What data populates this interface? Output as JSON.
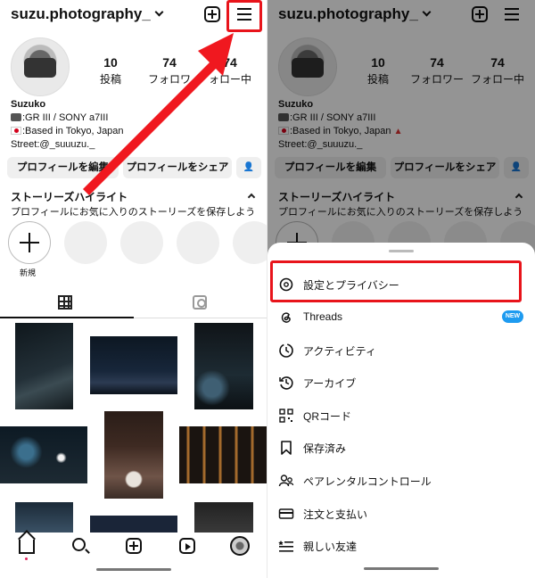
{
  "profile": {
    "username": "suzu.photography_",
    "posts": "10",
    "posts_label": "投稿",
    "followers": "74",
    "followers_label": "フォロワー",
    "following": "74",
    "following_label": "フォロー中",
    "name": "Suzuko",
    "bio_camera": ":GR III / SONY a7III",
    "bio_location": ":Based in Tokyo, Japan",
    "bio_street": "Street:@_suuuzu._",
    "edit_label": "プロフィールを編集",
    "share_label": "プロフィールをシェア"
  },
  "left_ui": {
    "followers_label_visible": "フォロワ",
    "following_label_visible": "ォロー中",
    "edit_label_visible": "プロフィールを編集",
    "share_label_visible": "プロフィールをシェア"
  },
  "highlights": {
    "title": "ストーリーズハイライト",
    "subtitle": "プロフィールにお気に入りのストーリーズを保存しよう",
    "new_label": "新規"
  },
  "menu": {
    "new_badge": "NEW",
    "items": [
      {
        "label": "設定とプライバシー",
        "icon": "settings-icon"
      },
      {
        "label": "Threads",
        "icon": "threads-icon"
      },
      {
        "label": "アクティビティ",
        "icon": "activity-icon"
      },
      {
        "label": "アーカイブ",
        "icon": "archive-icon"
      },
      {
        "label": "QRコード",
        "icon": "qr-code-icon"
      },
      {
        "label": "保存済み",
        "icon": "bookmark-icon"
      },
      {
        "label": "ペアレンタルコントロール",
        "icon": "parental-control-icon"
      },
      {
        "label": "注文と支払い",
        "icon": "card-icon"
      },
      {
        "label": "親しい友達",
        "icon": "close-friends-icon"
      }
    ]
  },
  "colors": {
    "highlight": "#e8141b",
    "badge": "#1e9bf0"
  }
}
